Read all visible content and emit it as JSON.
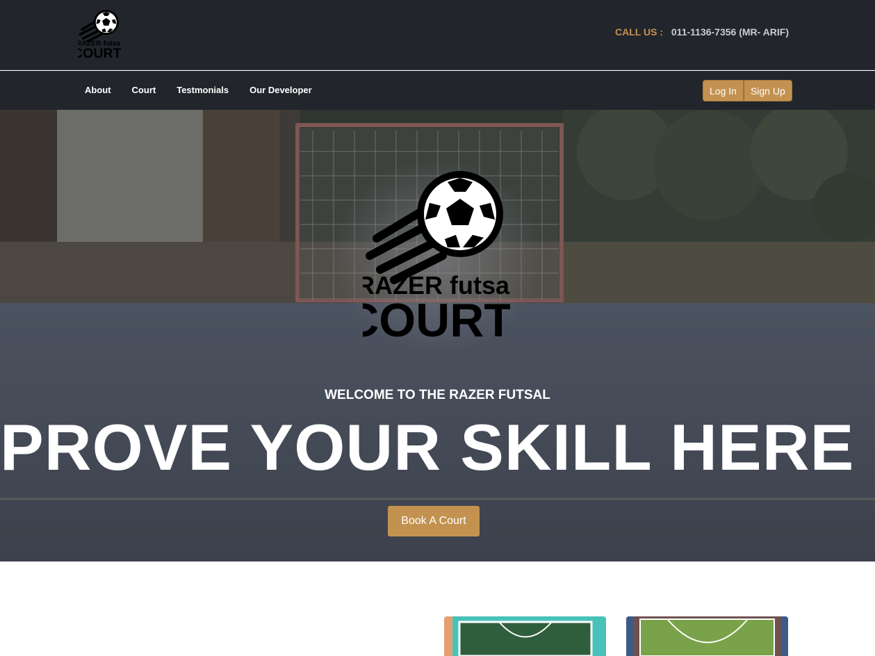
{
  "logo": {
    "line1": "RAZER futsal",
    "line2": "COURT"
  },
  "header": {
    "call_label": "CALL US :",
    "call_number": "011-1136-7356 (MR- ARIF)"
  },
  "nav": {
    "items": [
      {
        "label": "About"
      },
      {
        "label": "Court"
      },
      {
        "label": "Testmonials"
      },
      {
        "label": "Our Developer"
      }
    ],
    "login_label": "Log In",
    "signup_label": "Sign Up"
  },
  "hero": {
    "welcome": "WELCOME TO THE RAZER FUTSAL",
    "headline": "PROVE YOUR SKILL HERE !!",
    "cta_label": "Book A Court"
  },
  "colors": {
    "header_bg": "#22252b",
    "accent": "#c39250",
    "call_label": "#c49250",
    "text_light": "#ffffff"
  },
  "icons": {
    "logo": "soccer-ball-logo"
  }
}
